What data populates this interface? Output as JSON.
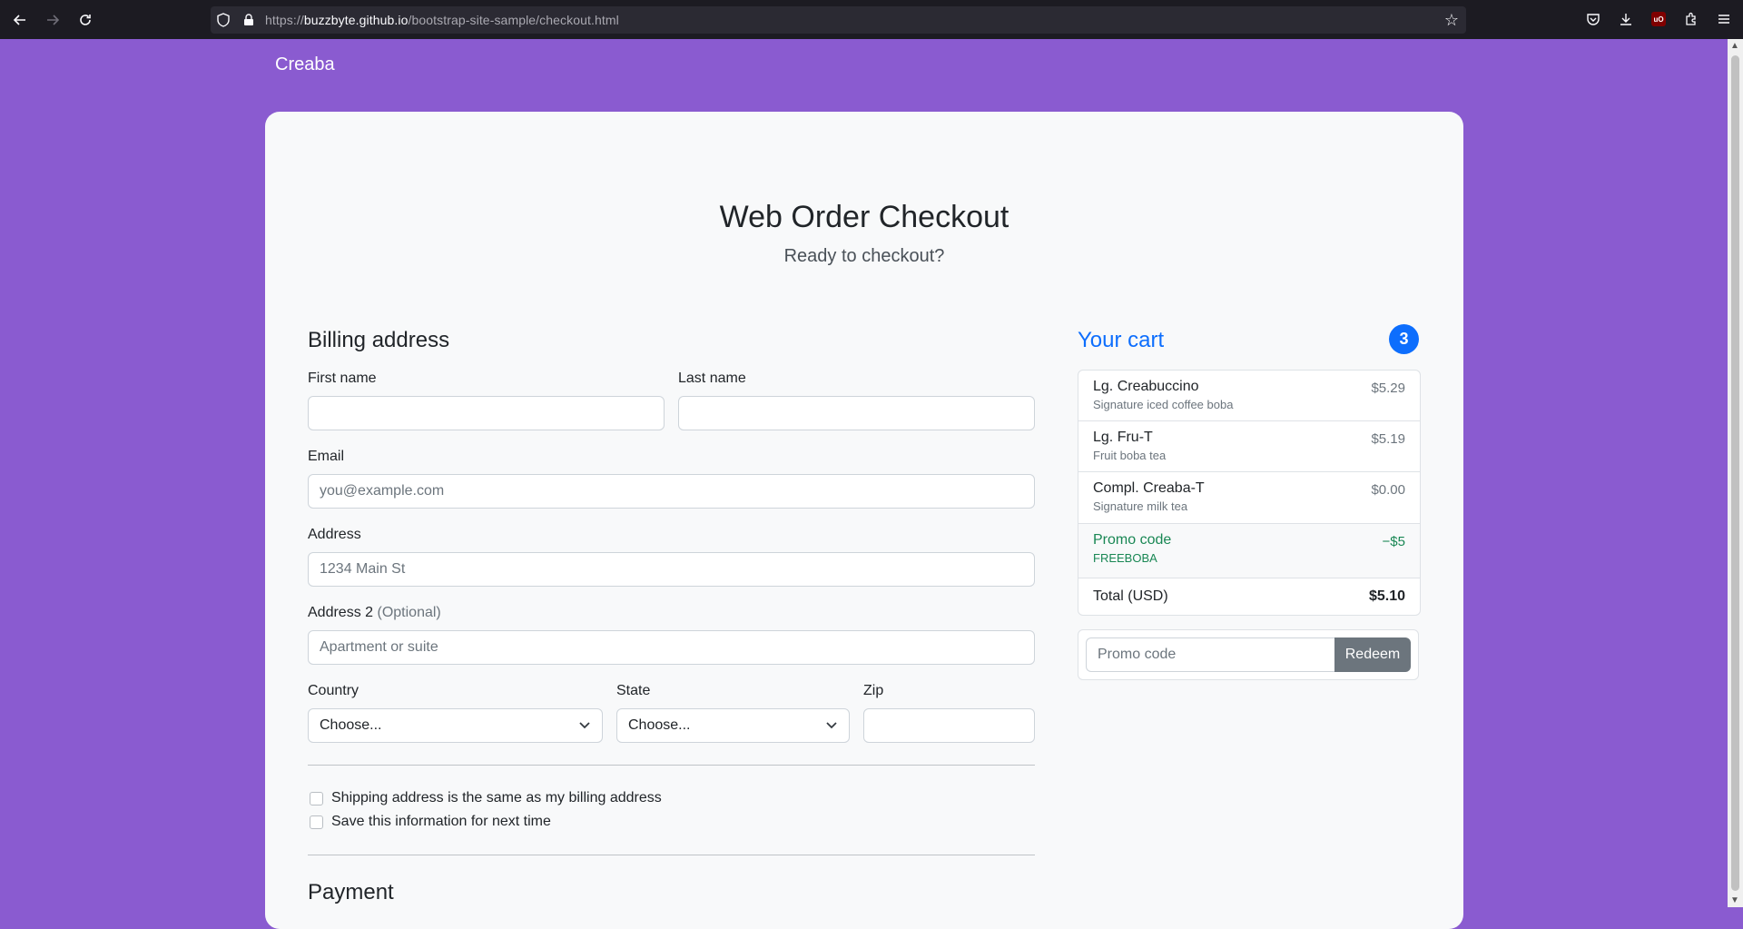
{
  "browser": {
    "url_prefix": "https://",
    "url_host": "buzzbyte.github.io",
    "url_path": "/bootstrap-site-sample/checkout.html",
    "icons": [
      "back-icon",
      "forward-icon",
      "reload-icon",
      "shield-icon",
      "lock-icon",
      "bookmark-star-icon",
      "pocket-icon",
      "download-icon",
      "ublock-icon",
      "extensions-icon",
      "menu-icon"
    ],
    "ublock_label": "uO"
  },
  "brand": "Creaba",
  "header": {
    "title": "Web Order Checkout",
    "subtitle": "Ready to checkout?"
  },
  "billing": {
    "title": "Billing address",
    "first_name_label": "First name",
    "last_name_label": "Last name",
    "email_label": "Email",
    "email_placeholder": "you@example.com",
    "address_label": "Address",
    "address_placeholder": "1234 Main St",
    "address2_label": "Address 2",
    "address2_optional": "(Optional)",
    "address2_placeholder": "Apartment or suite",
    "country_label": "Country",
    "country_value": "Choose...",
    "state_label": "State",
    "state_value": "Choose...",
    "zip_label": "Zip",
    "same_address_label": "Shipping address is the same as my billing address",
    "save_info_label": "Save this information for next time"
  },
  "payment": {
    "title": "Payment"
  },
  "cart": {
    "title": "Your cart",
    "count": "3",
    "items": [
      {
        "name": "Lg. Creabuccino",
        "desc": "Signature iced coffee boba",
        "price": "$5.29"
      },
      {
        "name": "Lg. Fru-T",
        "desc": "Fruit boba tea",
        "price": "$5.19"
      },
      {
        "name": "Compl. Creaba-T",
        "desc": "Signature milk tea",
        "price": "$0.00"
      }
    ],
    "promo": {
      "name": "Promo code",
      "code": "FREEBOBA",
      "amount": "−$5"
    },
    "total_label": "Total (USD)",
    "total_value": "$5.10",
    "promo_placeholder": "Promo code",
    "redeem_label": "Redeem"
  },
  "colors": {
    "background": "#8a5bd0",
    "primary": "#0d6efd",
    "success": "#198754",
    "secondary": "#6c757d"
  }
}
